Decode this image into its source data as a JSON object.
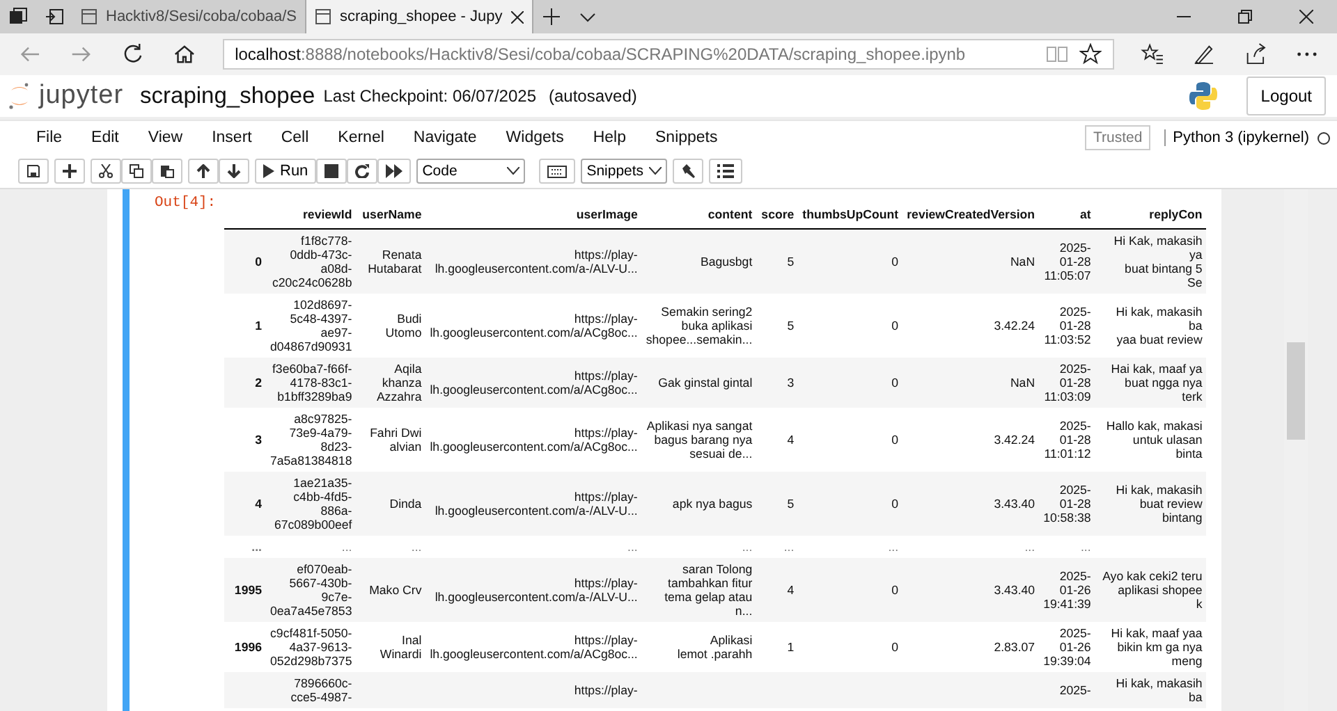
{
  "browser": {
    "tabs": [
      {
        "title": "Hacktiv8/Sesi/coba/cobaa/S",
        "selected": false
      },
      {
        "title": "scraping_shopee - Jupy",
        "selected": true
      }
    ],
    "address": {
      "host": "localhost",
      "path": ":8888/notebooks/Hacktiv8/Sesi/coba/cobaa/SCRAPING%20DATA/scraping_shopee.ipynb"
    }
  },
  "header": {
    "logo": "jupyter",
    "notebook_name": "scraping_shopee",
    "checkpoint": "Last Checkpoint: 06/07/2025",
    "autosave": "(autosaved)",
    "logout": "Logout"
  },
  "menu": {
    "items": [
      "File",
      "Edit",
      "View",
      "Insert",
      "Cell",
      "Kernel",
      "Navigate",
      "Widgets",
      "Help",
      "Snippets"
    ],
    "trusted": "Trusted",
    "kernel": "Python 3 (ipykernel)"
  },
  "toolbar": {
    "run": "Run",
    "cell_type": "Code",
    "snippets": "Snippets"
  },
  "output": {
    "prompt": "Out[4]:",
    "table": {
      "columns": [
        "reviewId",
        "userName",
        "userImage",
        "content",
        "score",
        "thumbsUpCount",
        "reviewCreatedVersion",
        "at",
        "replyCon"
      ],
      "rows": [
        {
          "kind": "data",
          "index": "0",
          "cells": [
            "f1f8c778-\n0ddb-473c-\na08d-\nc20c24c0628b",
            "Renata\nHutabarat",
            "https://play-\nlh.googleusercontent.com/a-/ALV-U...",
            "Bagusbgt",
            "5",
            "0",
            "NaN",
            "2025-\n01-28\n11:05:07",
            "Hi Kak, makasih ya\nbuat bintang 5\nSe"
          ]
        },
        {
          "kind": "data",
          "index": "1",
          "cells": [
            "102d8697-\n5c48-4397-\nae97-\nd04867d90931",
            "Budi\nUtomo",
            "https://play-\nlh.googleusercontent.com/a/ACg8oc...",
            "Semakin sering2\nbuka aplikasi\nshopee...semakin...",
            "5",
            "0",
            "3.42.24",
            "2025-\n01-28\n11:03:52",
            "Hi kak, makasih ba\nyaa buat review"
          ]
        },
        {
          "kind": "data",
          "index": "2",
          "cells": [
            "f3e60ba7-f66f-\n4178-83c1-\nb1bff3289ba9",
            "Aqila\nkhanza\nAzzahra",
            "https://play-\nlh.googleusercontent.com/a/ACg8oc...",
            "Gak ginstal gintal",
            "3",
            "0",
            "NaN",
            "2025-\n01-28\n11:03:09",
            "Hai kak, maaf ya\nbuat ngga nya\nterk"
          ]
        },
        {
          "kind": "data",
          "index": "3",
          "cells": [
            "a8c97825-\n73e9-4a79-\n8d23-\n7a5a81384818",
            "Fahri Dwi\nalvian",
            "https://play-\nlh.googleusercontent.com/a/ACg8oc...",
            "Aplikasi nya sangat\nbagus barang nya\nsesuai de...",
            "4",
            "0",
            "3.42.24",
            "2025-\n01-28\n11:01:12",
            "Hallo kak, makasi\nuntuk ulasan\nbinta"
          ]
        },
        {
          "kind": "data",
          "index": "4",
          "cells": [
            "1ae21a35-\nc4bb-4fd5-\n886a-\n67c089b00eef",
            "Dinda",
            "https://play-\nlh.googleusercontent.com/a-/ALV-U...",
            "apk nya bagus",
            "5",
            "0",
            "3.43.40",
            "2025-\n01-28\n10:58:38",
            "Hi kak, makasih\nbuat review\nbintang"
          ]
        },
        {
          "kind": "ellipsis",
          "index": "...",
          "cells": [
            "...",
            "...",
            "...",
            "...",
            "...",
            "...",
            "...",
            "...",
            null
          ]
        },
        {
          "kind": "data",
          "index": "1995",
          "cells": [
            "ef070eab-\n5667-430b-\n9c7e-\n0ea7a45e7853",
            "Mako Crv",
            "https://play-\nlh.googleusercontent.com/a-/ALV-U...",
            "saran Tolong\ntambahkan fitur\ntema gelap atau\nn...",
            "4",
            "0",
            "3.43.40",
            "2025-\n01-26\n19:41:39",
            "Ayo kak ceki2 teru\naplikasi shopee\nk"
          ]
        },
        {
          "kind": "data",
          "index": "1996",
          "cells": [
            "c9cf481f-5050-\n4a37-9613-\n052d298b7375",
            "Inal\nWinardi",
            "https://play-\nlh.googleusercontent.com/a/ACg8oc...",
            "Aplikasi\nlemot .parahh",
            "1",
            "0",
            "2.83.07",
            "2025-\n01-26\n19:39:04",
            "Hi kak, maaf yaa\nbikin km ga nya\nmeng"
          ]
        },
        {
          "kind": "cut",
          "index": null,
          "cells": [
            "7896660c-\ncce5-4987-",
            null,
            "https://play-",
            null,
            null,
            null,
            null,
            "2025-",
            "Hi kak, makasih ba"
          ]
        }
      ]
    }
  }
}
